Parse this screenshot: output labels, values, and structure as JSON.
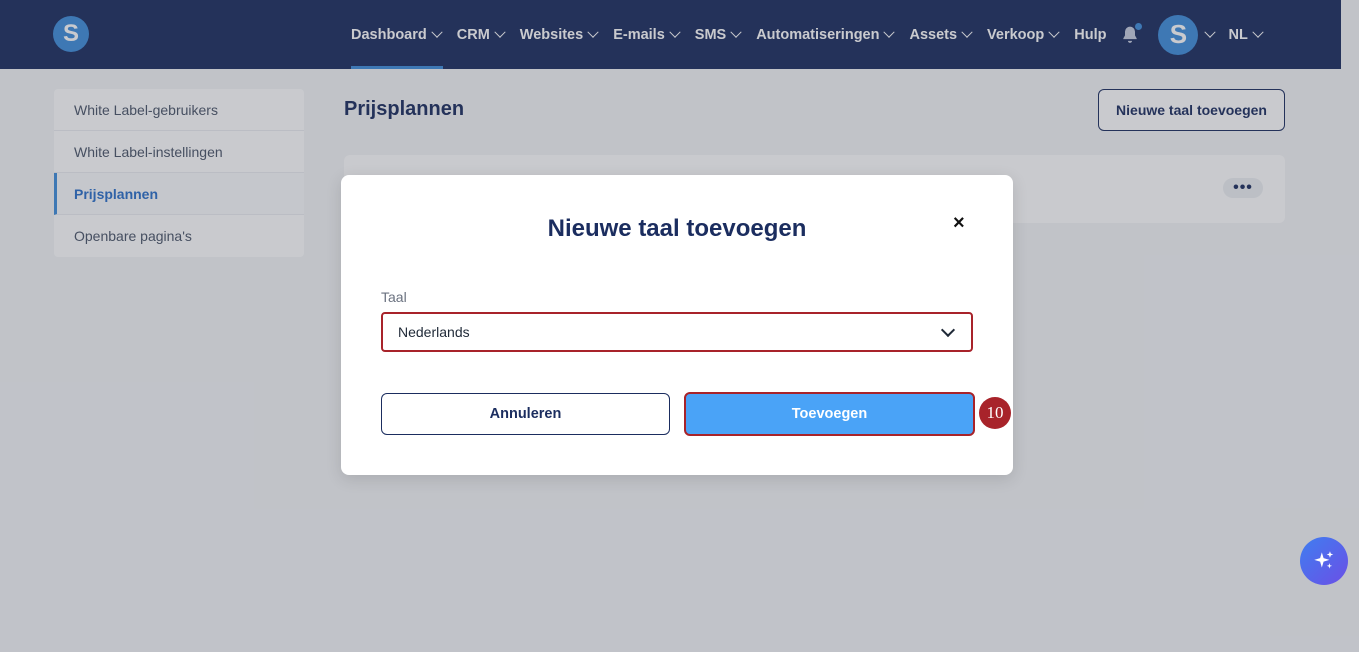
{
  "nav": {
    "logo_letter": "S",
    "items": [
      {
        "label": "Dashboard",
        "active": true
      },
      {
        "label": "CRM"
      },
      {
        "label": "Websites"
      },
      {
        "label": "E-mails"
      },
      {
        "label": "SMS"
      },
      {
        "label": "Automatiseringen"
      },
      {
        "label": "Assets"
      },
      {
        "label": "Verkoop"
      }
    ],
    "help_label": "Hulp",
    "avatar_letter": "S",
    "language": "NL"
  },
  "sidebar": {
    "items": [
      {
        "label": "White Label-gebruikers"
      },
      {
        "label": "White Label-instellingen"
      },
      {
        "label": "Prijsplannen",
        "active": true
      },
      {
        "label": "Openbare pagina's"
      }
    ]
  },
  "main": {
    "title": "Prijsplannen",
    "new_language_button": "Nieuwe taal toevoegen",
    "more_label": "•••"
  },
  "modal": {
    "title": "Nieuwe taal toevoegen",
    "close_label": "×",
    "field_label": "Taal",
    "selected_language": "Nederlands",
    "cancel_label": "Annuleren",
    "add_label": "Toevoegen"
  },
  "annotation": {
    "step_number": "10"
  },
  "colors": {
    "nav_bg": "#1b2d5f",
    "accent": "#3f8edb",
    "primary_button": "#4aa3f7",
    "highlight": "#a8232a"
  }
}
